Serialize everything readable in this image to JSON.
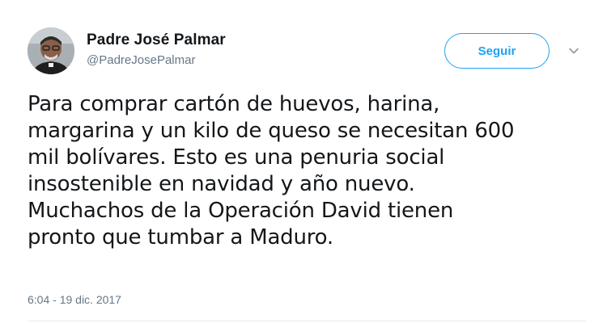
{
  "user": {
    "display_name": "Padre José Palmar",
    "screen_name": "@PadreJosePalmar",
    "avatar_icon": "profile-photo"
  },
  "actions": {
    "follow_label": "Seguir",
    "more_icon": "chevron-down-icon"
  },
  "tweet": {
    "text": "Para  comprar cartón de huevos, harina,\nmargarina y un kilo de queso se necesitan 600\nmil bolívares.  Esto es una penuria social\ninsostenible en navidad y año nuevo.\nMuchachos de la Operación David tienen\npronto que tumbar a Maduro.",
    "timestamp": "6:04 - 19 dic. 2017"
  },
  "colors": {
    "accent": "#1da1f2",
    "text": "#14171a",
    "secondary": "#657786",
    "divider": "#e6ecf0"
  }
}
